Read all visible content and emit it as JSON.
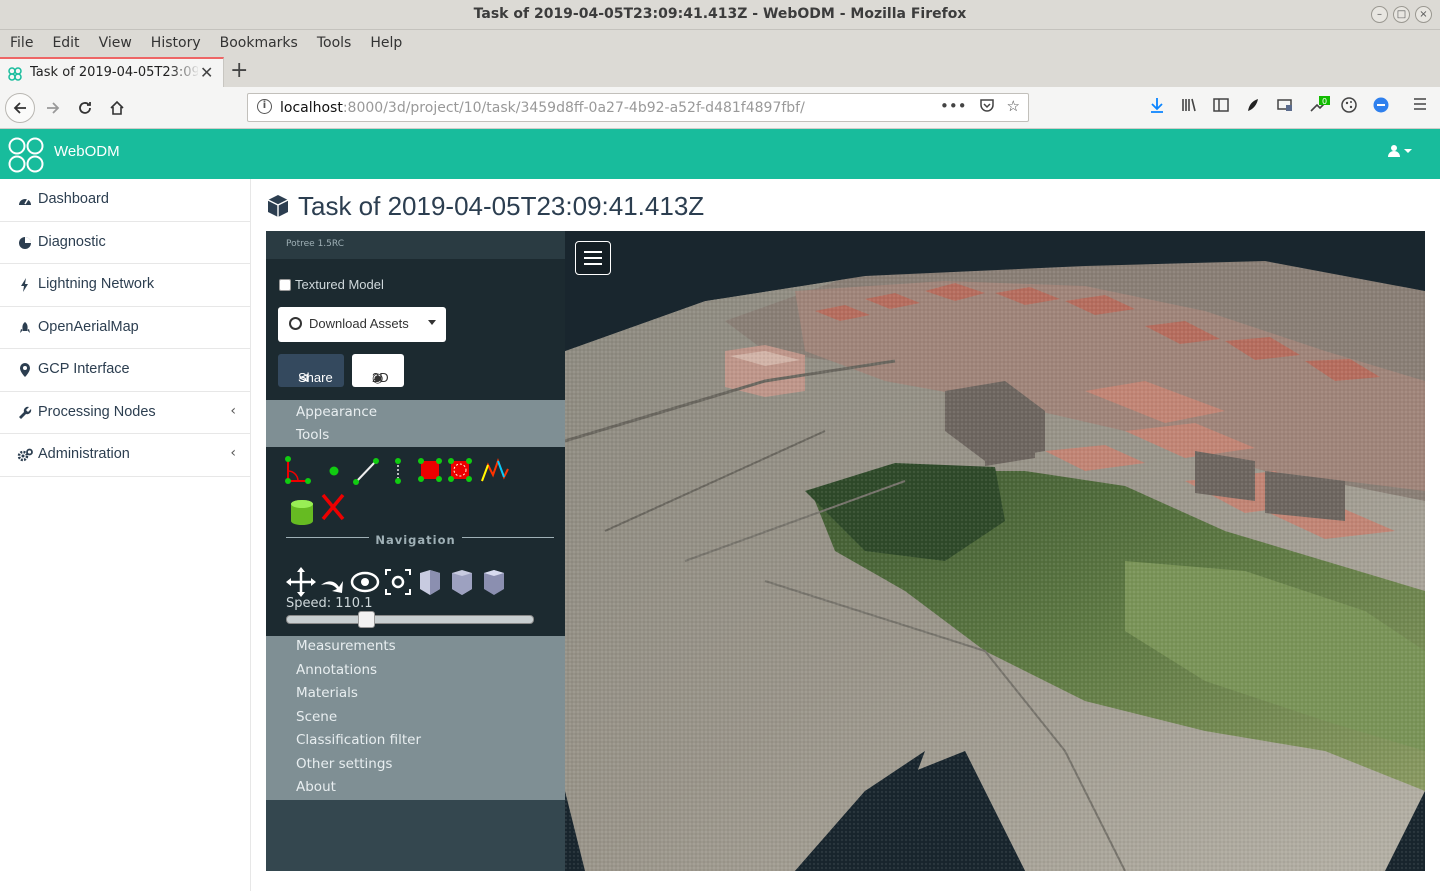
{
  "browser": {
    "window_title": "Task of 2019-04-05T23:09:41.413Z - WebODM - Mozilla Firefox",
    "menu": [
      "File",
      "Edit",
      "View",
      "History",
      "Bookmarks",
      "Tools",
      "Help"
    ],
    "tab_title": "Task of 2019-04-05T23:09:41.413Z - WebODM",
    "url_host": "localhost",
    "url_path": ":8000/3d/project/10/task/3459d8ff-0a27-4b92-a52f-d481f4897fbf/",
    "addon_badge": "0"
  },
  "app": {
    "brand": "WebODM",
    "accent_color": "#18bc9c"
  },
  "sidebar": {
    "items": [
      {
        "label": "Dashboard",
        "icon": "dashboard-icon"
      },
      {
        "label": "Diagnostic",
        "icon": "pie-chart-icon"
      },
      {
        "label": "Lightning Network",
        "icon": "bolt-icon"
      },
      {
        "label": "OpenAerialMap",
        "icon": "rocket-icon"
      },
      {
        "label": "GCP Interface",
        "icon": "map-marker-icon"
      },
      {
        "label": "Processing Nodes",
        "icon": "wrench-icon",
        "expandable": true
      },
      {
        "label": "Administration",
        "icon": "cogs-icon",
        "expandable": true
      }
    ]
  },
  "page": {
    "title": "Task of 2019-04-05T23:09:41.413Z"
  },
  "potree": {
    "version": "Potree 1.5RC",
    "textured_model_label": "Textured Model",
    "textured_model_checked": false,
    "download_label": "Download Assets",
    "share_label": "Share",
    "view2d_label": "2D",
    "sections_top": [
      "Appearance",
      "Tools"
    ],
    "navigation_label": "Navigation",
    "speed_label": "Speed: 110.1",
    "speed_fraction": 0.32,
    "sections_bottom": [
      "Measurements",
      "Annotations",
      "Materials",
      "Scene",
      "Classification filter",
      "Other settings",
      "About"
    ]
  }
}
